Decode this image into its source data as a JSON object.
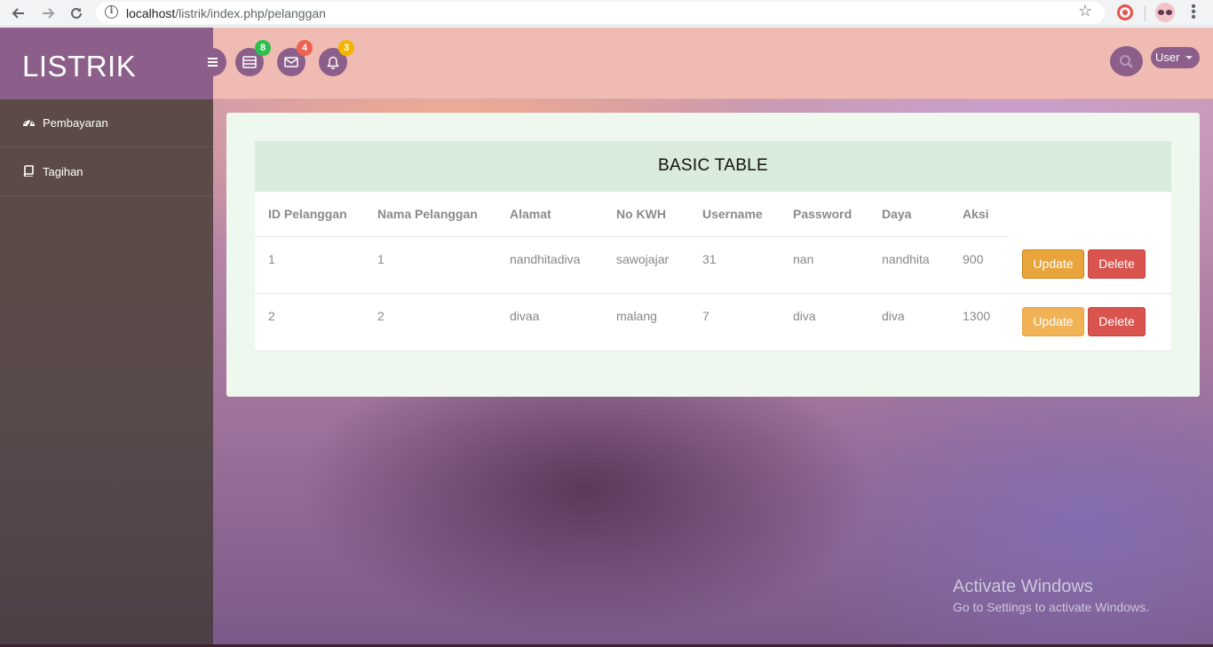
{
  "browser": {
    "url_host": "localhost",
    "url_path": "/listrik/index.php/pelanggan"
  },
  "sidebar": {
    "brand": "LISTRIK",
    "items": [
      {
        "label": "Pembayaran",
        "icon": "dashboard-icon"
      },
      {
        "label": "Tagihan",
        "icon": "book-icon"
      }
    ]
  },
  "header": {
    "badges": {
      "tasks": "8",
      "messages": "4",
      "notifications": "3"
    },
    "user_label": "User"
  },
  "table": {
    "title": "BASIC TABLE",
    "columns": [
      "ID Pelanggan",
      "Nama Pelanggan",
      "Alamat",
      "No KWH",
      "Username",
      "Password",
      "Daya",
      "Aksi"
    ],
    "rows": [
      {
        "cells": [
          "1",
          "1",
          "nandhitadiva",
          "sawojajar",
          "31",
          "nan",
          "nandhita",
          "900"
        ],
        "update": "Update",
        "delete": "Delete"
      },
      {
        "cells": [
          "2",
          "2",
          "divaa",
          "malang",
          "7",
          "diva",
          "diva",
          "1300"
        ],
        "update": "Update",
        "delete": "Delete"
      }
    ]
  },
  "watermark": {
    "line1": "Activate Windows",
    "line2": "Go to Settings to activate Windows."
  },
  "colors": {
    "brand": "#8b5f8a",
    "header": "#efbbb3",
    "badge_green": "#2ec04f",
    "badge_red": "#f0614f",
    "badge_yellow": "#f4b400",
    "update": "#e9a53b",
    "delete": "#d9534f"
  }
}
